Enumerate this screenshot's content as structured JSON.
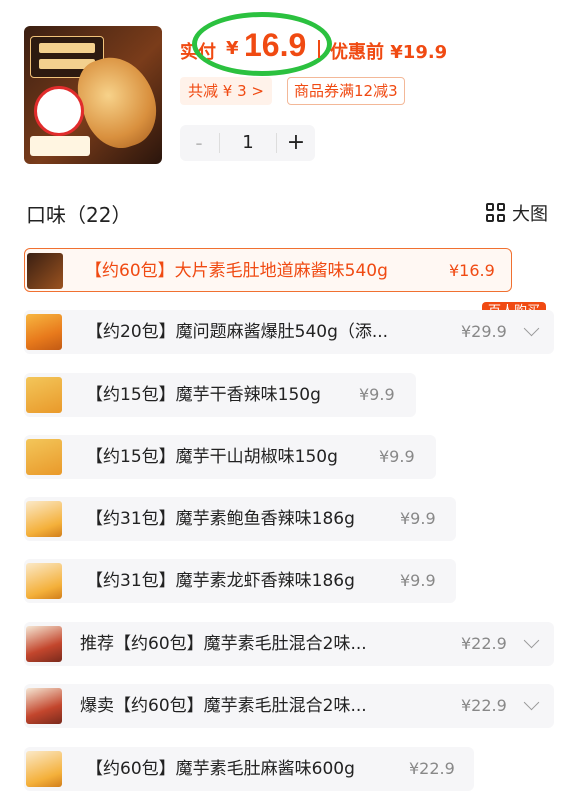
{
  "header": {
    "pay_label": "实付",
    "pay_currency": "¥",
    "pay_price": "16.9",
    "original_label": "优惠前 ¥19.9",
    "discount_label": "共减 ¥ 3 >",
    "coupon_label": "商品券满12减3",
    "quantity": "1",
    "minus": "-",
    "plus": "+"
  },
  "flavor": {
    "title": "口味（22）",
    "big_view_label": "大图"
  },
  "hot_badge": "百人购买",
  "options": [
    {
      "label": "【约60包】大片素毛肚地道麻酱味540g",
      "price": "¥16.9",
      "selected": true
    },
    {
      "label": "【约20包】魔问题麻酱爆肚540g（添...",
      "price": "¥29.9",
      "expand": true
    },
    {
      "label": "【约15包】魔芋干香辣味150g",
      "price": "¥9.9"
    },
    {
      "label": "【约15包】魔芋干山胡椒味150g",
      "price": "¥9.9"
    },
    {
      "label": "【约31包】魔芋素鲍鱼香辣味186g",
      "price": "¥9.9"
    },
    {
      "label": "【约31包】魔芋素龙虾香辣味186g",
      "price": "¥9.9"
    },
    {
      "label": "推荐【约60包】魔芋素毛肚混合2味...",
      "price": "¥22.9",
      "expand": true
    },
    {
      "label": "爆卖【约60包】魔芋素毛肚混合2味...",
      "price": "¥22.9",
      "expand": true
    },
    {
      "label": "【约60包】魔芋素毛肚麻酱味600g",
      "price": "¥22.9"
    }
  ],
  "colors": {
    "accent": "#f04a12",
    "highlight_ring": "#2bc13f"
  },
  "icons": {
    "big_view": "grid-icon",
    "expand": "chevron-down-icon"
  }
}
